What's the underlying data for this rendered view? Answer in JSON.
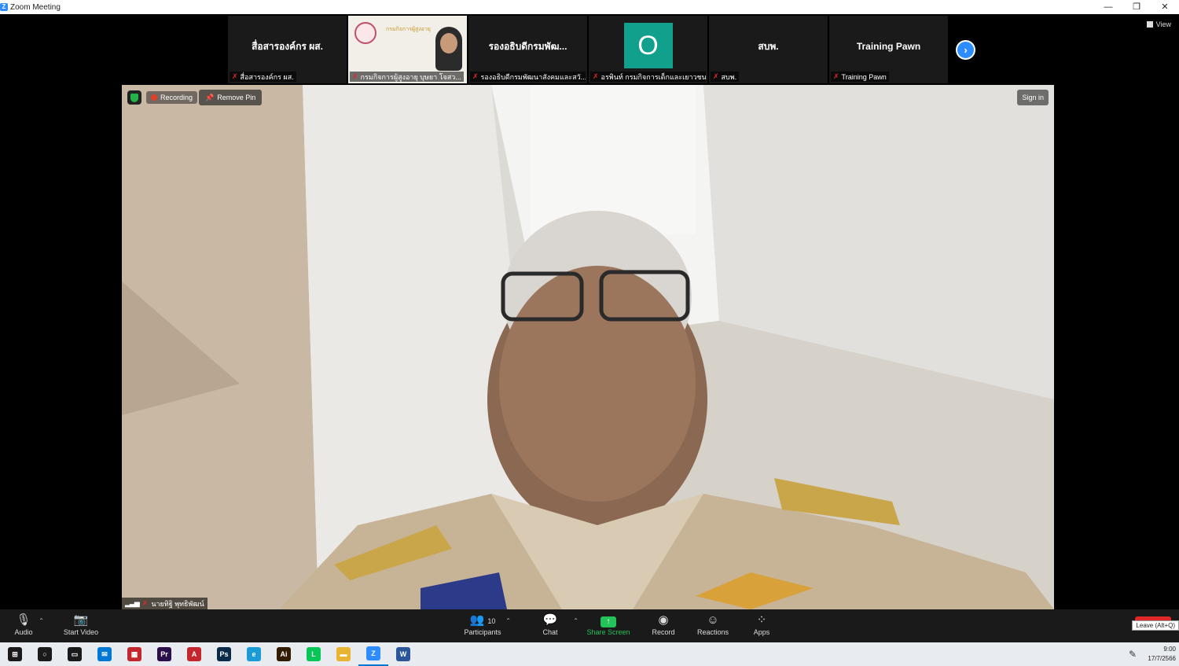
{
  "window": {
    "title": "Zoom Meeting",
    "controls": [
      "—",
      "❐",
      "✕"
    ]
  },
  "gallery": {
    "tiles": [
      {
        "big": "สื่อสารองค์กร ผส.",
        "label": "สื่อสารองค์กร ผส."
      },
      {
        "big": "",
        "label": "กรมกิจการผู้สูงอายุ บุษยา โจสว...",
        "photo_text": "กรมกิจการผู้สูงอายุ"
      },
      {
        "big": "รองอธิบดีกรมพัฒ...",
        "label": "รองอธิบดีกรมพัฒนาสังคมและสวั..."
      },
      {
        "big": "",
        "label": "อรพินท์ กรมกิจการเด็กและเยาวชน",
        "avatar": "O",
        "avatar_color": "#10a08c"
      },
      {
        "big": "สบพ.",
        "label": "สบพ."
      },
      {
        "big": "Training Pawn",
        "label": "Training Pawn"
      }
    ],
    "next_icon": "›",
    "view_label": "View"
  },
  "speaker": {
    "recording_label": "Recording",
    "remove_pin_label": "Remove Pin",
    "sign_in_label": "Sign in",
    "name_label": "นายทิฐิ พุทธิพัฒน์"
  },
  "toolbar": {
    "audio": {
      "label": "Audio",
      "icon": "🎙"
    },
    "video": {
      "label": "Start Video",
      "icon": "📷"
    },
    "participants": {
      "label": "Participants",
      "count": "10"
    },
    "chat": {
      "label": "Chat"
    },
    "share": {
      "label": "Share Screen",
      "icon": "↑"
    },
    "record": {
      "label": "Record"
    },
    "reactions": {
      "label": "Reactions"
    },
    "apps": {
      "label": "Apps"
    },
    "leave_hint": "Leave (Alt+Q)",
    "accent_green": "#23c35a",
    "leave_red": "#e02828"
  },
  "taskbar": {
    "apps": [
      {
        "name": "start",
        "glyph": "⊞",
        "color": "#1a1a1a"
      },
      {
        "name": "search",
        "glyph": "○",
        "color": "#1a1a1a"
      },
      {
        "name": "taskview",
        "glyph": "▭",
        "color": "#1a1a1a"
      },
      {
        "name": "mail",
        "glyph": "✉",
        "color": "#0078d4"
      },
      {
        "name": "store",
        "glyph": "▦",
        "color": "#c4262e"
      },
      {
        "name": "premiere",
        "glyph": "Pr",
        "color": "#2a0f4a"
      },
      {
        "name": "acrobat",
        "glyph": "A",
        "color": "#c4262e"
      },
      {
        "name": "photoshop",
        "glyph": "Ps",
        "color": "#0a2a4a"
      },
      {
        "name": "edge",
        "glyph": "e",
        "color": "#1a9ad6"
      },
      {
        "name": "illustrator",
        "glyph": "Ai",
        "color": "#331b00"
      },
      {
        "name": "line",
        "glyph": "L",
        "color": "#06c755"
      },
      {
        "name": "explorer",
        "glyph": "▬",
        "color": "#e8b432"
      },
      {
        "name": "zoom",
        "glyph": "Z",
        "color": "#2d8cff"
      },
      {
        "name": "word",
        "glyph": "W",
        "color": "#2b579a"
      }
    ],
    "time": "9:00",
    "date": "17/7/2566"
  }
}
